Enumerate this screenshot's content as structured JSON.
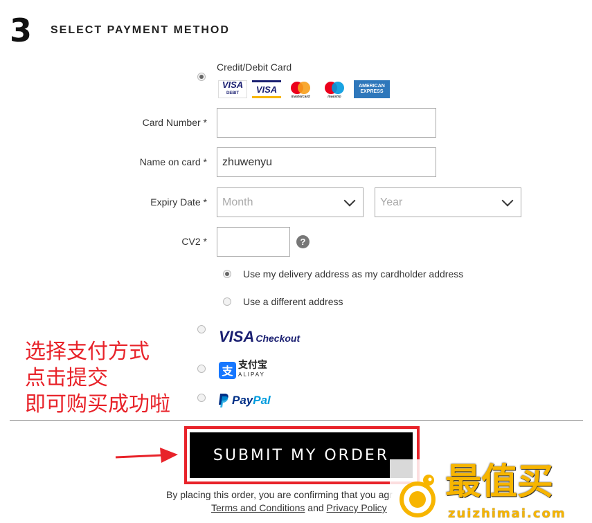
{
  "section": {
    "number": "3",
    "title": "SELECT PAYMENT METHOD"
  },
  "card_option": {
    "label": "Credit/Debit Card",
    "brands": [
      "VISA",
      "VISA",
      "mastercard",
      "maestro",
      "AMERICAN EXPRESS"
    ],
    "debit_caption": "DEBIT"
  },
  "form": {
    "card_number_label": "Card Number *",
    "card_number_value": "",
    "name_label": "Name on card *",
    "name_value": "zhuwenyu",
    "expiry_label": "Expiry Date *",
    "month_placeholder": "Month",
    "year_placeholder": "Year",
    "cv2_label": "CV2 *",
    "cv2_help": "?"
  },
  "address_options": [
    {
      "label": "Use my delivery address as my cardholder address",
      "selected": true
    },
    {
      "label": "Use a different address",
      "selected": false
    }
  ],
  "alt_methods": {
    "visa_checkout": {
      "visa": "VISA",
      "checkout": "Checkout"
    },
    "alipay": {
      "cn": "支付宝",
      "en": "ALIPAY"
    },
    "paypal": {
      "pay": "Pay",
      "pal": "Pal"
    }
  },
  "annotation": {
    "lines": [
      "选择支付方式",
      "点击提交",
      "即可购买成功啦"
    ]
  },
  "submit_label": "SUBMIT MY ORDER",
  "legal": {
    "text": "By placing this order, you are confirming that you agr",
    "terms": "Terms and Conditions",
    "and": "and",
    "privacy": "Privacy Policy"
  },
  "watermark": {
    "title": "最值买",
    "url": "zuizhimai.com"
  },
  "colors": {
    "annotation_red": "#e8232a",
    "button_bg": "#000000",
    "visa_blue": "#1a1f71",
    "paypal_blue": "#003087",
    "alipay_blue": "#1677ff",
    "watermark_yellow": "#f7b500"
  }
}
